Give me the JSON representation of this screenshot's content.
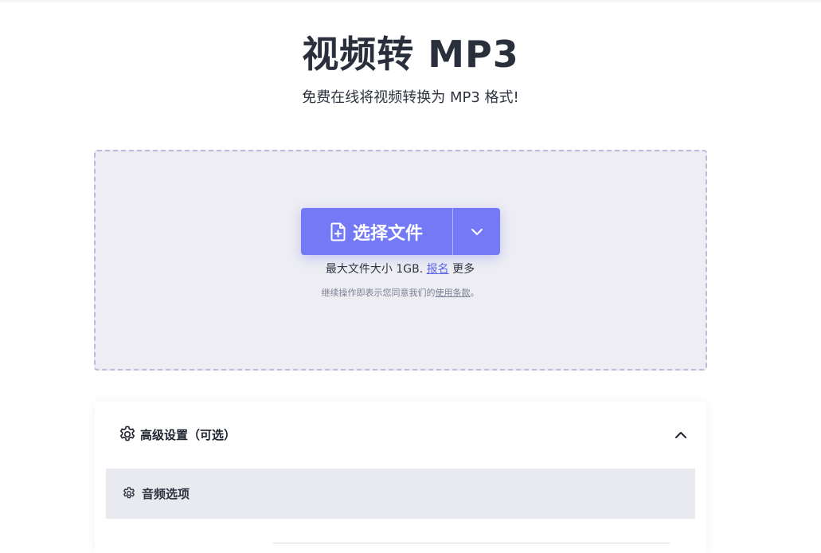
{
  "page": {
    "title": "视频转 MP3",
    "subtitle": "免费在线将视频转换为 MP3 格式!"
  },
  "upload": {
    "choose_file_label": "选择文件",
    "limit_text": "最大文件大小 1GB.",
    "signup_link": "报名",
    "more_text": "更多",
    "terms_prefix": "继续操作即表示您同意我们的",
    "terms_link": "使用条款",
    "terms_suffix": "。"
  },
  "settings": {
    "header_label": "高级设置（可选）",
    "audio_section_label": "音频选项"
  },
  "icons": {
    "file_plus": "file-plus-icon",
    "chevron_down": "chevron-down-icon",
    "gear": "gear-icon",
    "chevron_up": "chevron-up-icon"
  },
  "colors": {
    "primary": "#7479f5",
    "dropzone_bg": "#ededf3",
    "dropzone_border": "#bdbbdd",
    "link": "#5b63e8",
    "section_bg": "#e8eaef"
  }
}
